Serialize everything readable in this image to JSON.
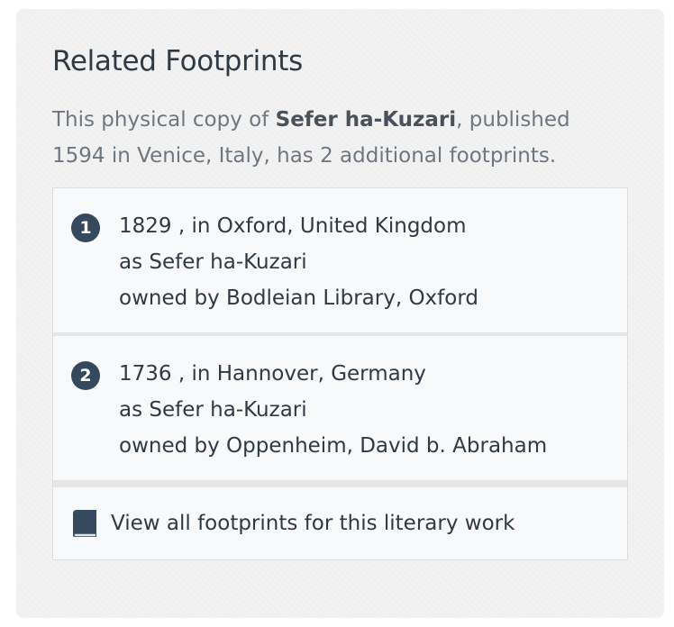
{
  "panel": {
    "title": "Related Footprints",
    "summary": {
      "prefix": "This physical copy of ",
      "work_title": "Sefer ha-Kuzari",
      "suffix": ", published 1594 in Venice, Italy, has 2 additional footprints."
    }
  },
  "footprints": [
    {
      "number": "1",
      "date_place": "1829 , in Oxford, United Kingdom",
      "as_title": "as Sefer ha-Kuzari",
      "owner": "owned by Bodleian Library, Oxford"
    },
    {
      "number": "2",
      "date_place": "1736 , in Hannover, Germany",
      "as_title": "as Sefer ha-Kuzari",
      "owner": "owned by Oppenheim, David b. Abraham"
    }
  ],
  "view_all": {
    "icon": "book-icon",
    "label": "View all footprints for this literary work"
  },
  "colors": {
    "badge": "#34495e",
    "panel_bg": "#f2f2f2",
    "item_bg": "#f7f9fa",
    "muted_text": "#6e7780",
    "text": "#2f3a45"
  }
}
